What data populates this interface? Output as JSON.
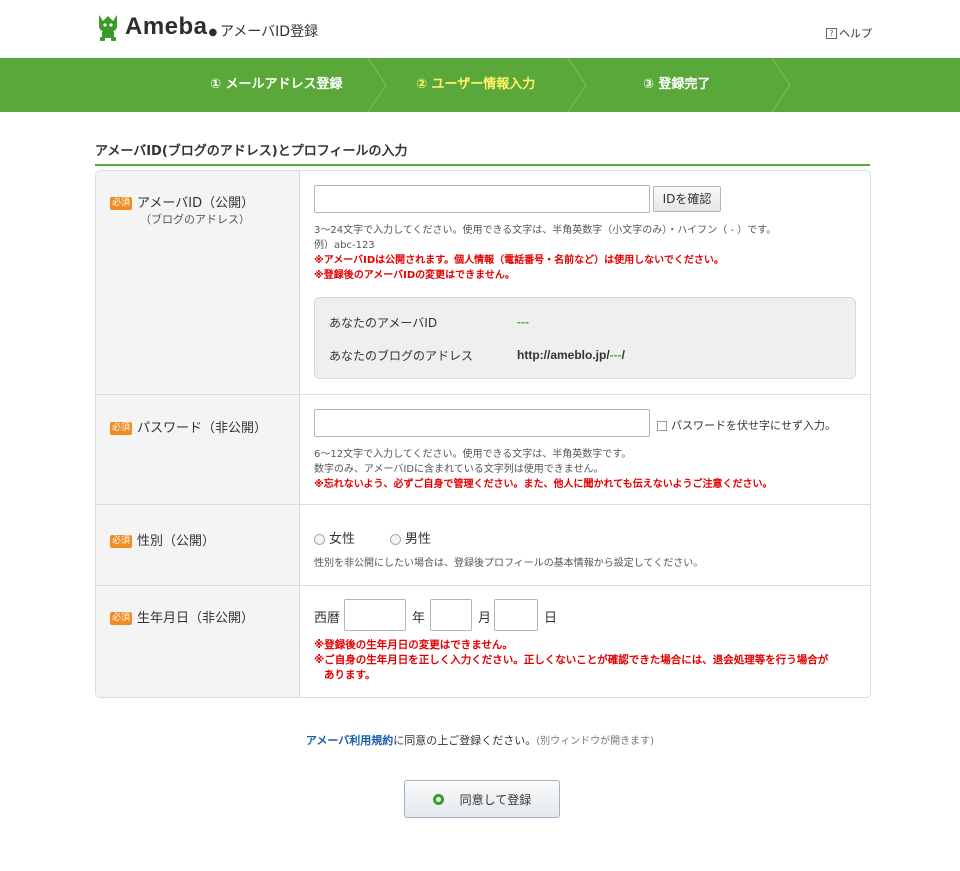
{
  "header": {
    "logo_text": "Ameba",
    "page_title": "アメーバID登録",
    "help_icon_glyph": "?",
    "help_label": "ヘルプ"
  },
  "steps": [
    {
      "label": "① メールアドレス登録",
      "active": false
    },
    {
      "label": "② ユーザー情報入力",
      "active": true
    },
    {
      "label": "③ 登録完了",
      "active": false
    }
  ],
  "section_title": "アメーバID(ブログのアドレス)とプロフィールの入力",
  "required_badge": "必須",
  "rows": {
    "ameba_id": {
      "label": "アメーバID（公開）",
      "sublabel": "（ブログのアドレス）",
      "value": "",
      "check_button": "IDを確認",
      "note1": "3〜24文字で入力してください。使用できる文字は、半角英数字（小文字のみ）・ハイフン（ - ）です。",
      "note2": "例）abc-123",
      "warn1": "※アメーバIDは公開されます。個人情報（電話番号・名前など）は使用しないでください。",
      "warn2": "※登録後のアメーバIDの変更はできません。",
      "preview_id_label": "あなたのアメーバID",
      "preview_id_value": "---",
      "preview_blog_label": "あなたのブログのアドレス",
      "preview_blog_prefix": "http://ameblo.jp/",
      "preview_blog_id": "---",
      "preview_blog_suffix": "/"
    },
    "password": {
      "label": "パスワード（非公開）",
      "value": "",
      "show_checkbox_label": "パスワードを伏せ字にせず入力。",
      "note1": "6〜12文字で入力してください。使用できる文字は、半角英数字です。",
      "note2": "数字のみ、アメーバIDに含まれている文字列は使用できません。",
      "warn1": "※忘れないよう、必ずご自身で管理ください。また、他人に聞かれても伝えないようご注意ください。"
    },
    "gender": {
      "label": "性別（公開）",
      "option_female": "女性",
      "option_male": "男性",
      "note1": "性別を非公開にしたい場合は、登録後プロフィールの基本情報から設定してください。"
    },
    "birthday": {
      "label": "生年月日（非公開）",
      "era": "西暦",
      "year_unit": "年",
      "month_unit": "月",
      "day_unit": "日",
      "warn1": "※登録後の生年月日の変更はできません。",
      "warn2": "※ご自身の生年月日を正しく入力ください。正しくないことが確認できた場合には、退会処理等を行う場合が",
      "warn3": "あります。"
    }
  },
  "terms": {
    "link": "アメーバ利用規約",
    "text": "に同意の上ご登録ください。",
    "sub": "(別ウィンドウが開きます)"
  },
  "submit_label": "同意して登録",
  "colors": {
    "brand_green": "#5aa83a",
    "active_step": "#fff568",
    "warning_red": "#e30000",
    "required_orange": "#f08c22"
  }
}
